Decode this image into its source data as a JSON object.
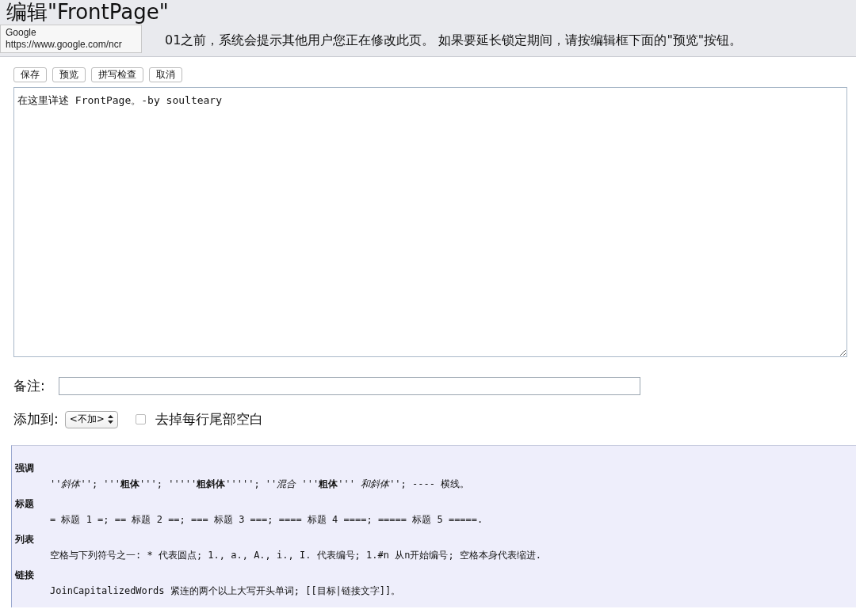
{
  "page": {
    "title": "编辑\"FrontPage\"",
    "notice": "01之前，系统会提示其他用户您正在修改此页。 如果要延长锁定期间，请按编辑框下面的\"预览\"按钮。"
  },
  "tooltip": {
    "title": "Google",
    "url": "https://www.google.com/ncr"
  },
  "buttons": [
    "保存",
    "预览",
    "拼写检查",
    "取消"
  ],
  "editor": {
    "value": "在这里详述 FrontPage。-by soulteary"
  },
  "comment": {
    "label": "备注:"
  },
  "add_to": {
    "label": "添加到:",
    "value": "<不加>"
  },
  "trim_whitespace": {
    "label": "去掉每行尾部空白",
    "checked": false
  },
  "help": [
    {
      "term": "强调",
      "description": "''*斜体*''; '''**粗体**'''; '''''**粗斜体**'''''; ''*混合* '''**粗体**''' *和斜体*''; ---- 横线。"
    },
    {
      "term": "标题",
      "description": "= 标题 1 =; == 标题 2 ==; === 标题 3 ===; ==== 标题 4 ====; ===== 标题 5 =====."
    },
    {
      "term": "列表",
      "description": "空格与下列符号之一: * 代表圆点; 1., a., A., i., I. 代表编号; 1.#n 从n开始编号; 空格本身代表缩进."
    },
    {
      "term": "链接",
      "description": "JoinCapitalizedWords 紧连的两个以上大写开头单词; [[目标|链接文字]]。"
    }
  ]
}
